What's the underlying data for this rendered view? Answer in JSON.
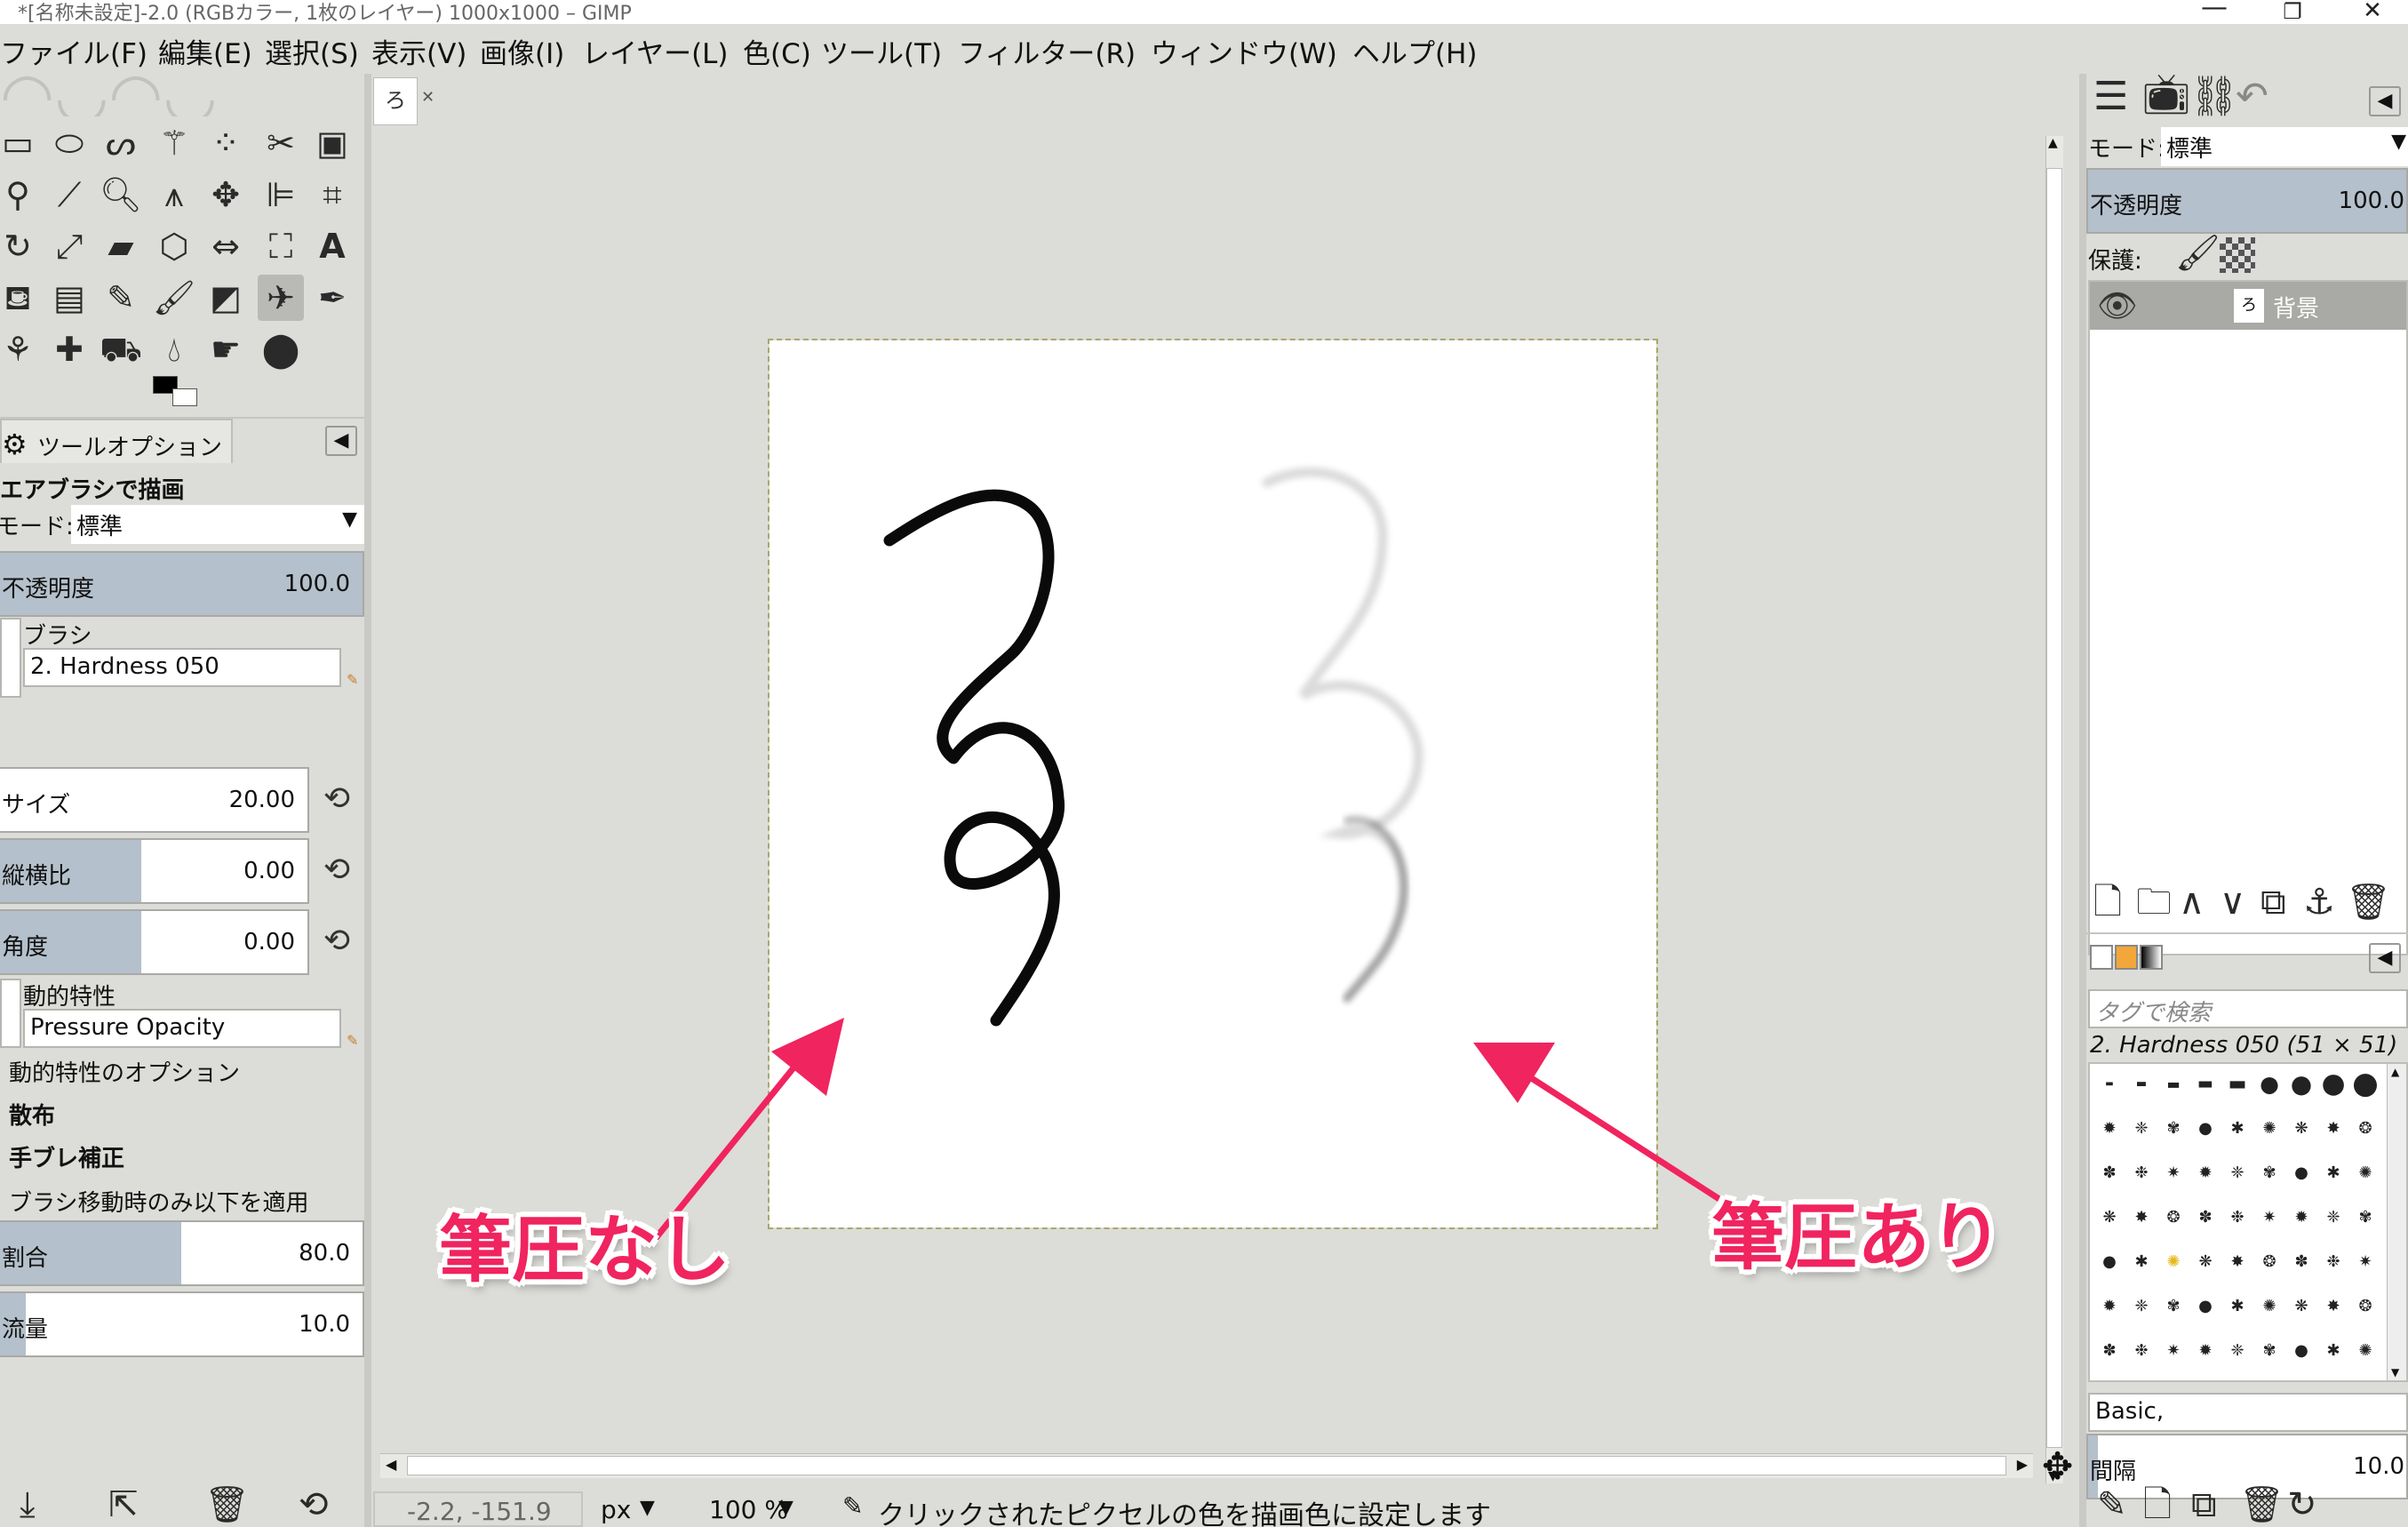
{
  "window": {
    "title": "*[名称未設定]-2.0 (RGBカラー, 1枚のレイヤー) 1000x1000 – GIMP",
    "minimize": "—",
    "maximize": "❐",
    "close": "✕"
  },
  "menu": {
    "items": [
      "ファイル(F)",
      "編集(E)",
      "選択(S)",
      "表示(V)",
      "画像(I)",
      "レイヤー(L)",
      "色(C)",
      "ツール(T)",
      "フィルター(R)",
      "ウィンドウ(W)",
      "ヘルプ(H)"
    ]
  },
  "tool_options": {
    "tab_label": "ツールオプション",
    "tool_name": "エアブラシで描画",
    "mode_label": "モード:",
    "mode_value": "標準",
    "opacity_label": "不透明度",
    "opacity_value": "100.0",
    "brush_label": "ブラシ",
    "brush_value": "2. Hardness 050",
    "size_label": "サイズ",
    "size_value": "20.00",
    "aspect_label": "縦横比",
    "aspect_value": "0.00",
    "angle_label": "角度",
    "angle_value": "0.00",
    "dynamics_label": "動的特性",
    "dynamics_value": "Pressure Opacity",
    "dynamics_options": "動的特性のオプション",
    "scatter": "散布",
    "smooth": "手ブレ補正",
    "motion_only": "ブラシ移動時のみ以下を適用",
    "rate_label": "割合",
    "rate_value": "80.0",
    "rate_fraction": 0.5,
    "flow_label": "流量",
    "flow_value": "10.0",
    "flow_fraction": 0.07
  },
  "canvas": {
    "tab_thumb": "ろ",
    "callout_left": "筆圧なし",
    "callout_right": "筆圧あり"
  },
  "status": {
    "coords": "-2.2, -151.9",
    "unit": "px",
    "zoom": "100 %",
    "message": "クリックされたピクセルの色を描画色に設定します"
  },
  "layers": {
    "mode_label": "モード:",
    "mode_value": "標準",
    "opacity_label": "不透明度",
    "opacity_value": "100.0",
    "lock_label": "保護:",
    "layer_name": "背景",
    "layer_thumb": "ろ"
  },
  "brushes": {
    "tag_placeholder": "タグで検索",
    "current": "2. Hardness 050 (51 × 51)",
    "preset": "Basic,",
    "spacing_label": "間隔",
    "spacing_value": "10.0"
  },
  "colors": {
    "accent": "#f0245f",
    "slider_fill": "#b4c0cb",
    "layer_row": "#a9a9a5"
  }
}
